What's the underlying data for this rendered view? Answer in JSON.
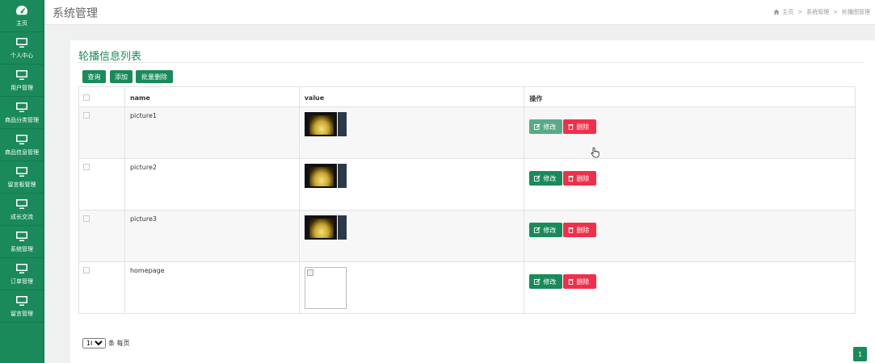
{
  "sidebar": {
    "items": [
      {
        "label": "主页",
        "icon": "dashboard-icon"
      },
      {
        "label": "个人中心",
        "icon": "monitor-icon"
      },
      {
        "label": "用户管理",
        "icon": "monitor-icon"
      },
      {
        "label": "商品分类管理",
        "icon": "monitor-icon"
      },
      {
        "label": "商品信息管理",
        "icon": "monitor-icon"
      },
      {
        "label": "留言板管理",
        "icon": "monitor-icon"
      },
      {
        "label": "成长交流",
        "icon": "monitor-icon"
      },
      {
        "label": "系统管理",
        "icon": "monitor-icon"
      },
      {
        "label": "订单管理",
        "icon": "monitor-icon"
      },
      {
        "label": "留言管理",
        "icon": "monitor-icon"
      }
    ]
  },
  "header": {
    "title": "系统管理",
    "breadcrumb": [
      "主页",
      "系统管理",
      "轮播图管理"
    ]
  },
  "panel": {
    "title": "轮播信息列表",
    "buttons": {
      "query": "查询",
      "add": "添加",
      "batch_delete": "批量删除"
    }
  },
  "table": {
    "headers": [
      "name",
      "value",
      "操作"
    ],
    "rows": [
      {
        "name": "picture1",
        "image": "photo"
      },
      {
        "name": "picture2",
        "image": "photo"
      },
      {
        "name": "picture3",
        "image": "photo"
      },
      {
        "name": "homepage",
        "image": "broken"
      }
    ],
    "edit_label": "修改",
    "delete_label": "删除"
  },
  "pagination": {
    "page_size": "10",
    "page_size_options": [
      "10"
    ],
    "per_page_text": "条 每页",
    "current_page": "1"
  },
  "colors": {
    "primary": "#1a8a5a",
    "danger": "#f0304a",
    "edit_hover": "#5aaa88"
  }
}
